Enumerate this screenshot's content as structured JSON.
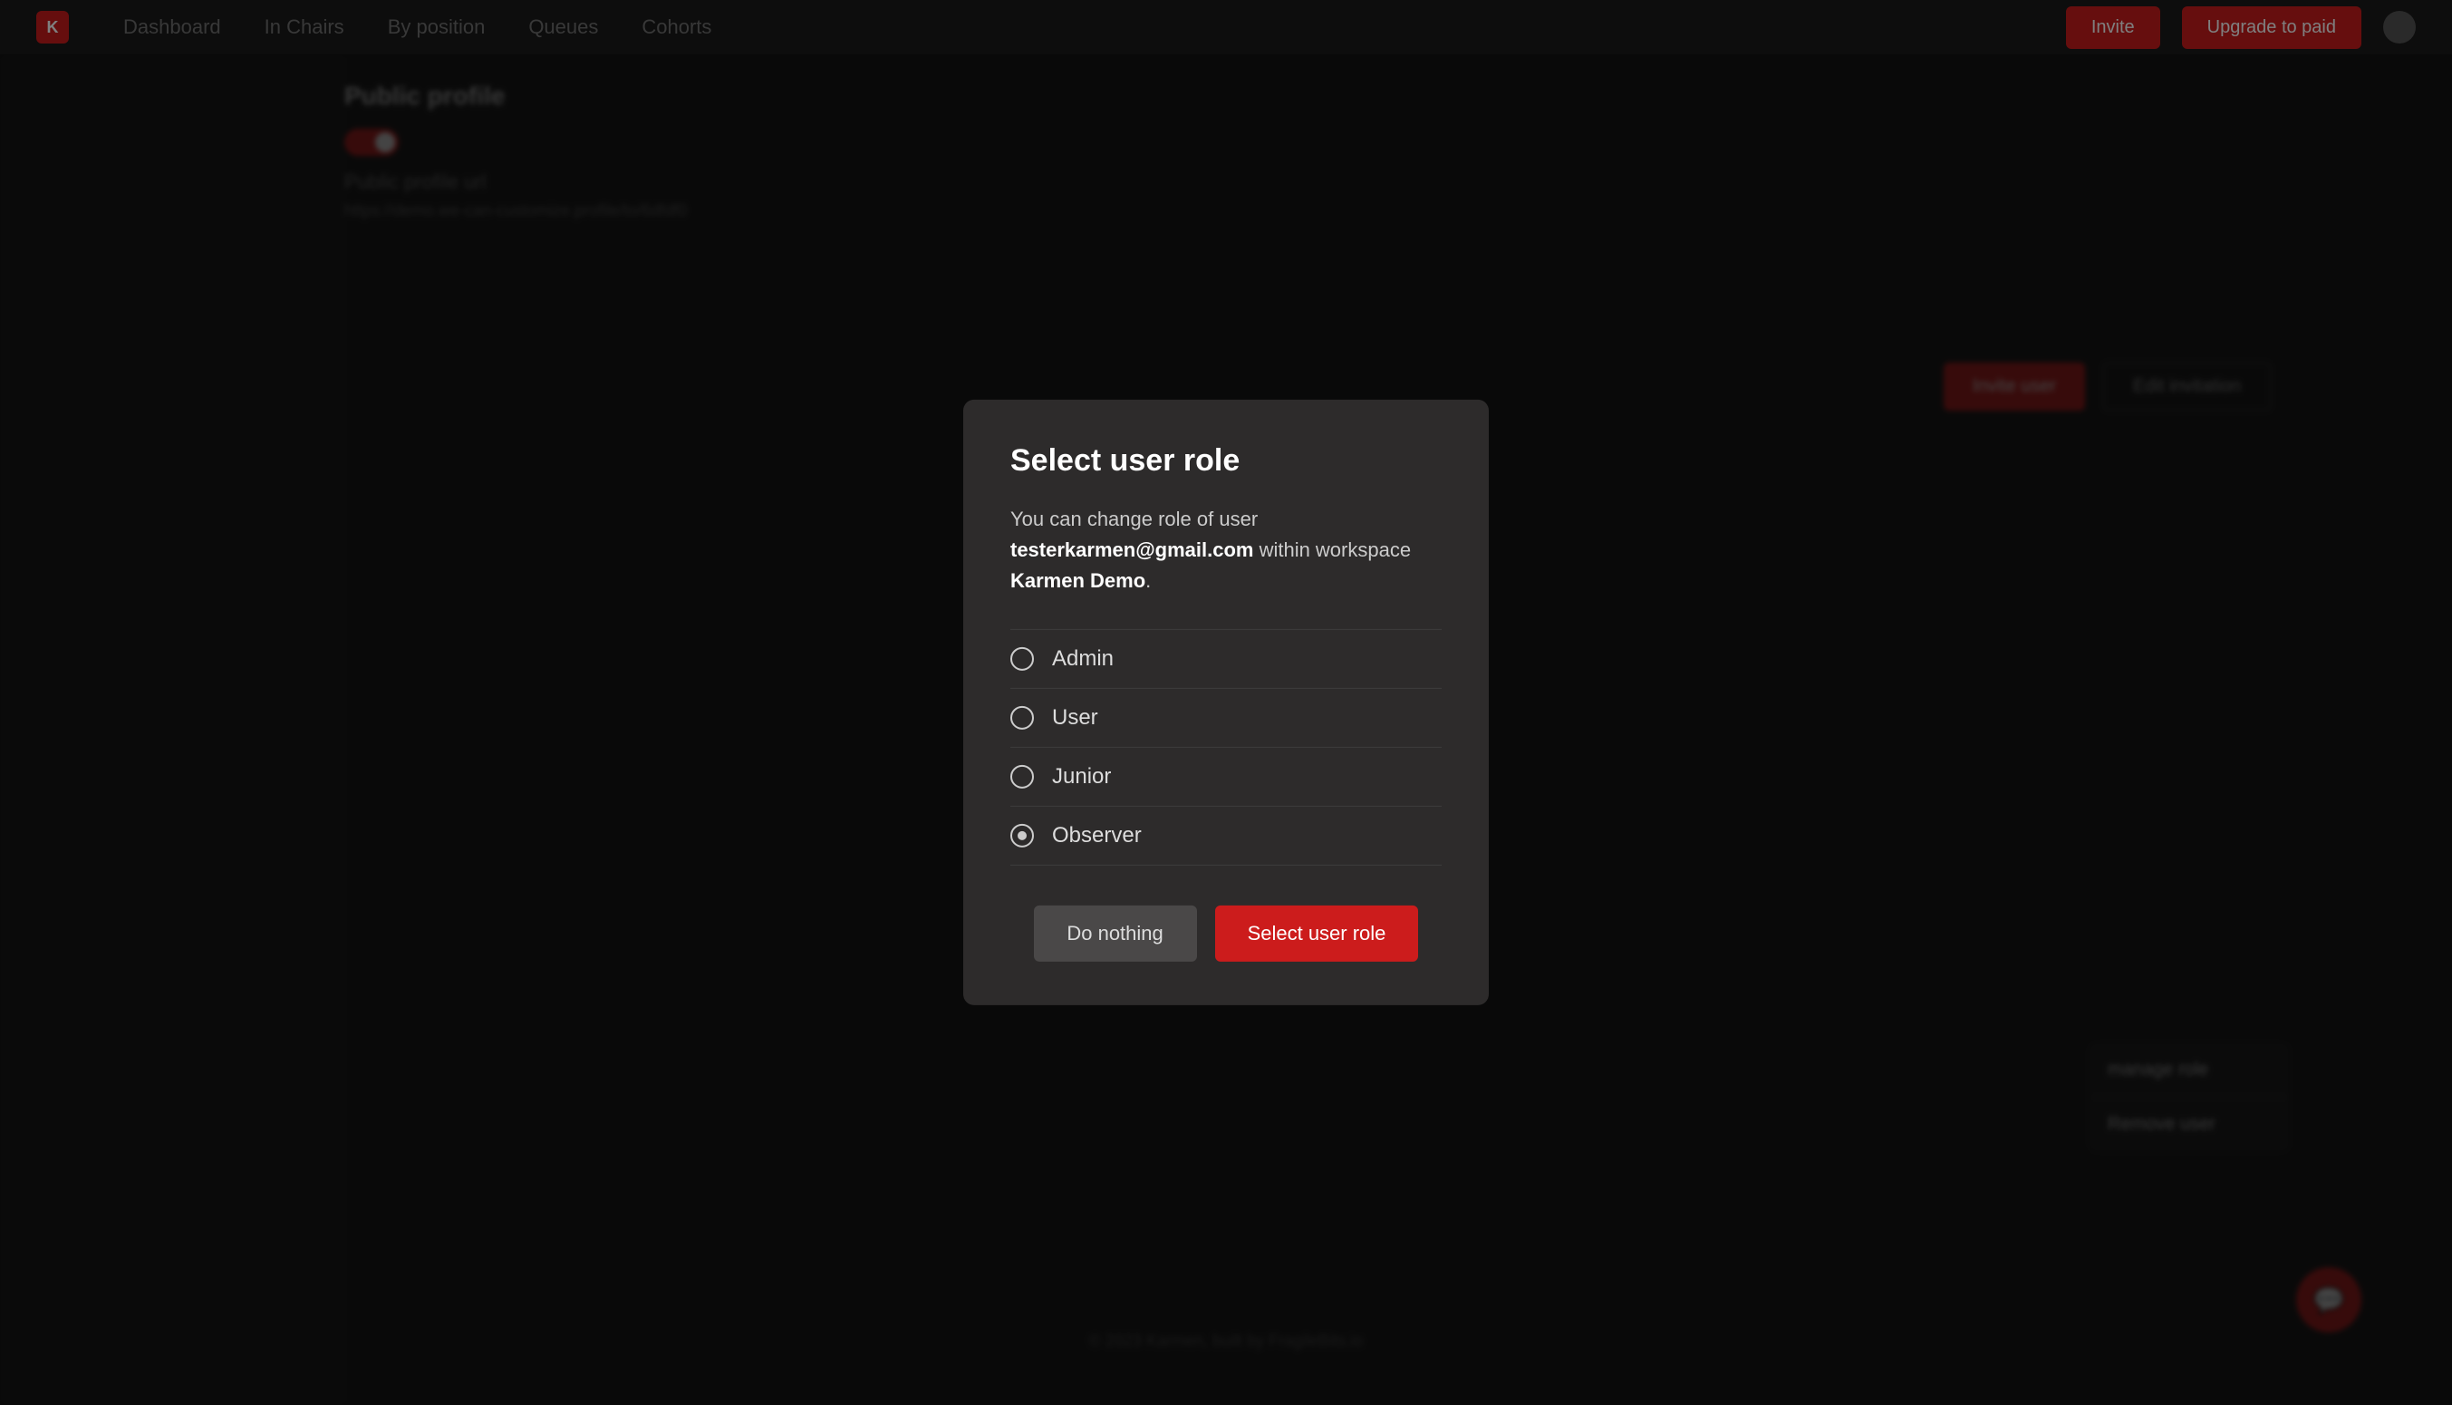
{
  "topnav": {
    "logo": "K",
    "links": [
      "Dashboard",
      "In Chairs",
      "By position",
      "Queues",
      "Cohorts"
    ],
    "btn_invite": "Invite",
    "btn_upgrade": "Upgrade to paid",
    "colors": {
      "accent": "#cc1c1c"
    }
  },
  "background": {
    "section_title": "Public profile",
    "toggle_label": "Public profile url",
    "description": "https://demo.we-can-customize.profile/to/6dfdf0",
    "btn_invite_user": "Invite user",
    "btn_edit_invitation": "Edit invitation",
    "dropdown_items": [
      "manage role",
      "Remove user"
    ],
    "footer_text": "© 2023 Karmen, built by FragileBits.io"
  },
  "modal": {
    "title": "Select user role",
    "description_prefix": "You can change role of user ",
    "user_email": "testerkarmen@gmail.com",
    "description_mid": " within\nworkspace ",
    "workspace_name": "Karmen Demo",
    "description_suffix": ".",
    "roles": [
      {
        "id": "admin",
        "label": "Admin",
        "selected": false
      },
      {
        "id": "user",
        "label": "User",
        "selected": false
      },
      {
        "id": "junior",
        "label": "Junior",
        "selected": false
      },
      {
        "id": "observer",
        "label": "Observer",
        "selected": true
      }
    ],
    "btn_cancel": "Do nothing",
    "btn_confirm": "Select user role"
  }
}
